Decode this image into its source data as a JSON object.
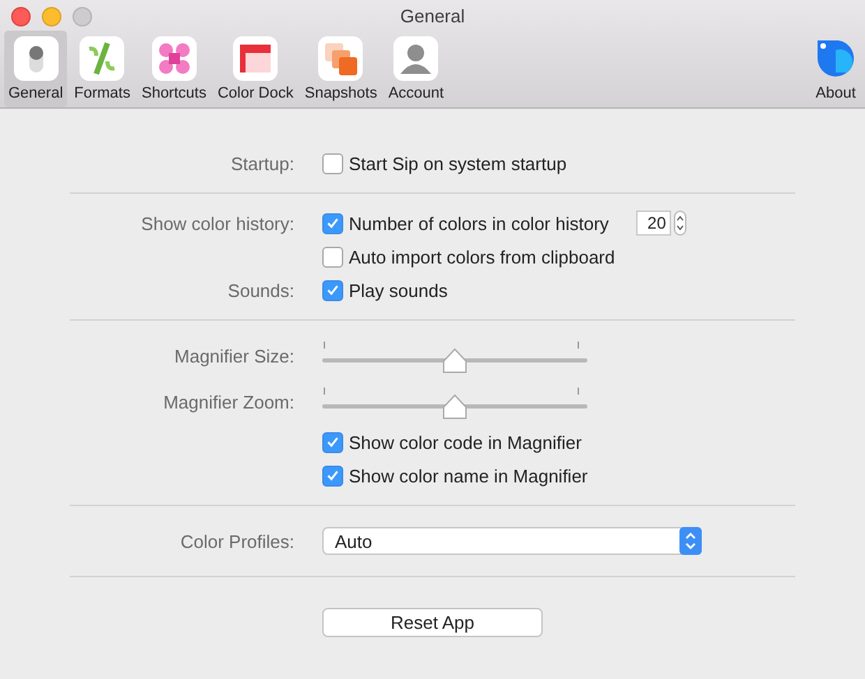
{
  "window": {
    "title": "General"
  },
  "toolbar": {
    "items": [
      {
        "label": "General",
        "kind": "general",
        "selected": true
      },
      {
        "label": "Formats",
        "kind": "formats",
        "selected": false
      },
      {
        "label": "Shortcuts",
        "kind": "shortcuts",
        "selected": false
      },
      {
        "label": "Color Dock",
        "kind": "colordock",
        "selected": false
      },
      {
        "label": "Snapshots",
        "kind": "snapshots",
        "selected": false
      },
      {
        "label": "Account",
        "kind": "account",
        "selected": false
      },
      {
        "label": "About",
        "kind": "about",
        "selected": false
      }
    ]
  },
  "sections": [
    {
      "rows": [
        {
          "label": "Startup:",
          "kind": "checkbox",
          "text": "Start Sip on system startup",
          "checked": false
        }
      ]
    },
    {
      "rows": [
        {
          "label": "Show color history:",
          "kind": "checkbox",
          "text": "Number of colors in color history",
          "checked": true,
          "stepper": "20"
        },
        {
          "kind": "checkbox",
          "text": "Auto import colors from clipboard",
          "checked": false
        },
        {
          "label": "Sounds:",
          "kind": "checkbox",
          "text": "Play sounds",
          "checked": true
        }
      ]
    },
    {
      "rows": [
        {
          "label": "Magnifier Size:",
          "kind": "slider",
          "level": 0.5
        },
        {
          "label": "Magnifier Zoom:",
          "kind": "slider",
          "level": 0.5
        },
        {
          "kind": "checkbox",
          "text": "Show color code in Magnifier",
          "checked": true
        },
        {
          "kind": "checkbox",
          "text": "Show color name in Magnifier",
          "checked": true
        }
      ]
    },
    {
      "rows": [
        {
          "label": "Color Profiles:",
          "kind": "select",
          "value": "Auto"
        }
      ]
    },
    {
      "rows": [
        {
          "kind": "button",
          "text": "Reset App"
        }
      ]
    }
  ]
}
